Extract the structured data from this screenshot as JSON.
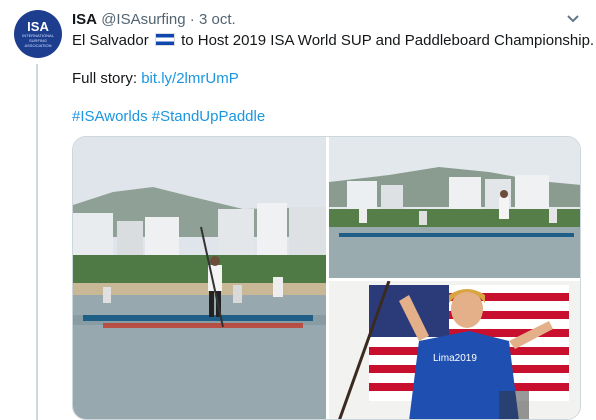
{
  "author": {
    "name": "ISA",
    "handle": "@ISAsurfing",
    "time": "3 oct.",
    "avatar_text": "ISA",
    "avatar_sub": "INTERNATIONAL SURFING ASSOCIATION"
  },
  "tweet": {
    "line1_before_flag": "El Salvador",
    "flag": "El Salvador flag",
    "line1_after_flag": "to Host 2019 ISA World SUP and Paddleboard Championship.",
    "story_label": "Full story:",
    "story_link": "bit.ly/2lmrUmP",
    "hashtag1": "#ISAworlds",
    "hashtag2": "#StandUpPaddle"
  },
  "photo_text": {
    "shirt": "Lima2019"
  },
  "icons": {
    "menu": "chevron-down-icon"
  },
  "colors": {
    "link": "#1b95e0",
    "text": "#14171a",
    "secondary": "#536471",
    "avatar": "#1d3d8f"
  }
}
